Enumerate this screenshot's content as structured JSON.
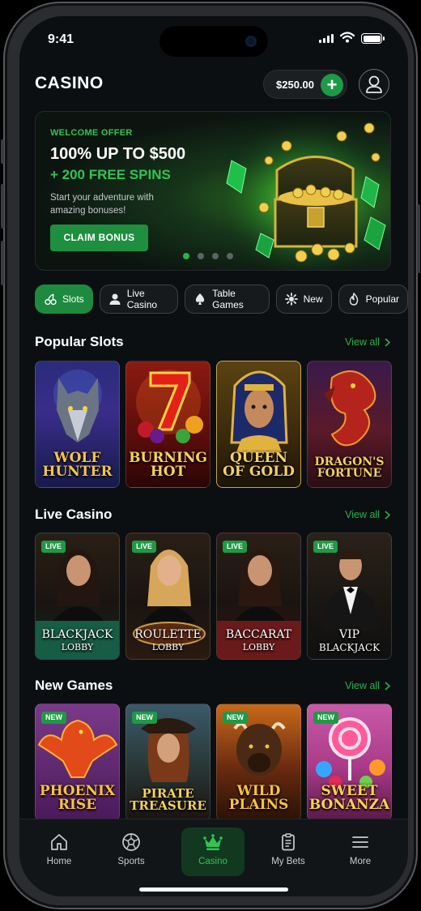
{
  "status": {
    "time": "9:41"
  },
  "header": {
    "brand": "CASINO",
    "balance": "$250.00"
  },
  "banner": {
    "label": "WELCOME OFFER",
    "title": "100% UP TO $500",
    "subtitle": "+ 200 FREE SPINS",
    "description": "Start your adventure with amazing bonuses!",
    "cta": "CLAIM BONUS",
    "slides_total": 4,
    "slide_active": 1
  },
  "categories": [
    {
      "label": "Slots",
      "icon": "cherries-icon",
      "active": true
    },
    {
      "label": "Live Casino",
      "icon": "person-icon",
      "active": false
    },
    {
      "label": "Table Games",
      "icon": "spade-icon",
      "active": false
    },
    {
      "label": "New",
      "icon": "sparkle-icon",
      "active": false
    },
    {
      "label": "Popular",
      "icon": "flame-icon",
      "active": false
    }
  ],
  "sections": {
    "popular_slots": {
      "title": "Popular Slots",
      "view_all": "View all",
      "items": [
        {
          "name": "WOLF HUNTER"
        },
        {
          "name": "BURNING HOT"
        },
        {
          "name": "QUEEN OF GOLD"
        },
        {
          "name": "DRAGON'S FORTUNE"
        }
      ]
    },
    "live_casino": {
      "title": "Live Casino",
      "view_all": "View all",
      "items": [
        {
          "badge": "LIVE",
          "name": "BLACKJACK",
          "sub": "LOBBY"
        },
        {
          "badge": "LIVE",
          "name": "ROULETTE",
          "sub": "LOBBY"
        },
        {
          "badge": "LIVE",
          "name": "BACCARAT",
          "sub": "LOBBY"
        },
        {
          "badge": "LIVE",
          "name": "VIP",
          "sub": "BLACKJACK"
        }
      ]
    },
    "new_games": {
      "title": "New Games",
      "view_all": "View all",
      "items": [
        {
          "badge": "NEW",
          "name": "PHOENIX RISE"
        },
        {
          "badge": "NEW",
          "name": "PIRATE TREASURE"
        },
        {
          "badge": "NEW",
          "name": "WILD PLAINS"
        },
        {
          "badge": "NEW",
          "name": "SWEET BONANZA"
        }
      ]
    }
  },
  "tabbar": [
    {
      "label": "Home",
      "icon": "home-icon",
      "active": false
    },
    {
      "label": "Sports",
      "icon": "soccer-ball-icon",
      "active": false
    },
    {
      "label": "Casino",
      "icon": "crown-icon",
      "active": true
    },
    {
      "label": "My Bets",
      "icon": "bet-slip-icon",
      "active": false
    },
    {
      "label": "More",
      "icon": "menu-icon",
      "active": false
    }
  ],
  "colors": {
    "accent": "#1e9a46",
    "accent_text": "#2bb24c",
    "background": "#0c0f11"
  }
}
